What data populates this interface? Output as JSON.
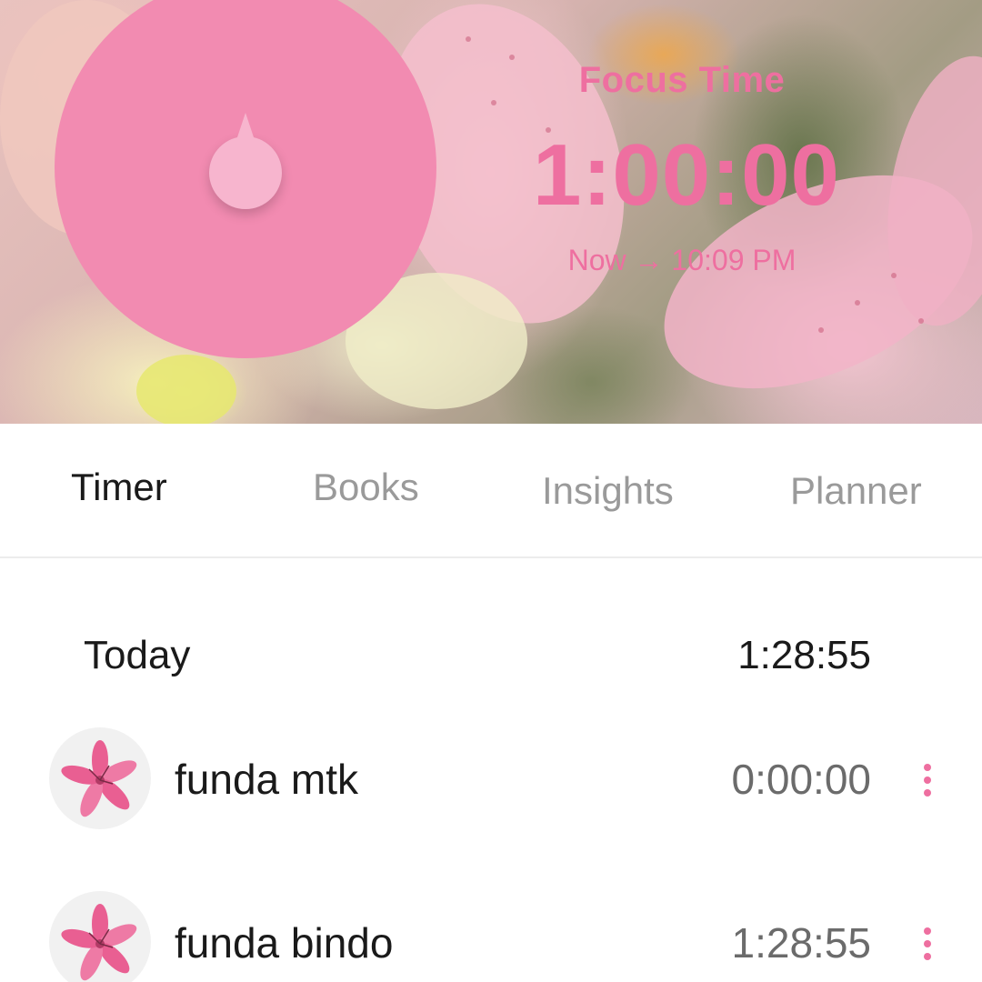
{
  "timer": {
    "label": "Focus Time",
    "remaining": "1:00:00",
    "range_text": "Now → 10:09 PM",
    "accent_color": "#ee6fa0"
  },
  "tabs": [
    {
      "label": "Timer",
      "active": true
    },
    {
      "label": "Books",
      "active": false
    },
    {
      "label": "Insights",
      "active": false
    },
    {
      "label": "Planner",
      "active": false
    }
  ],
  "today": {
    "label": "Today",
    "total": "1:28:55",
    "items": [
      {
        "name": "funda mtk",
        "time": "0:00:00",
        "icon": "lily-flower-icon"
      },
      {
        "name": "funda bindo",
        "time": "1:28:55",
        "icon": "lily-flower-icon"
      }
    ]
  }
}
